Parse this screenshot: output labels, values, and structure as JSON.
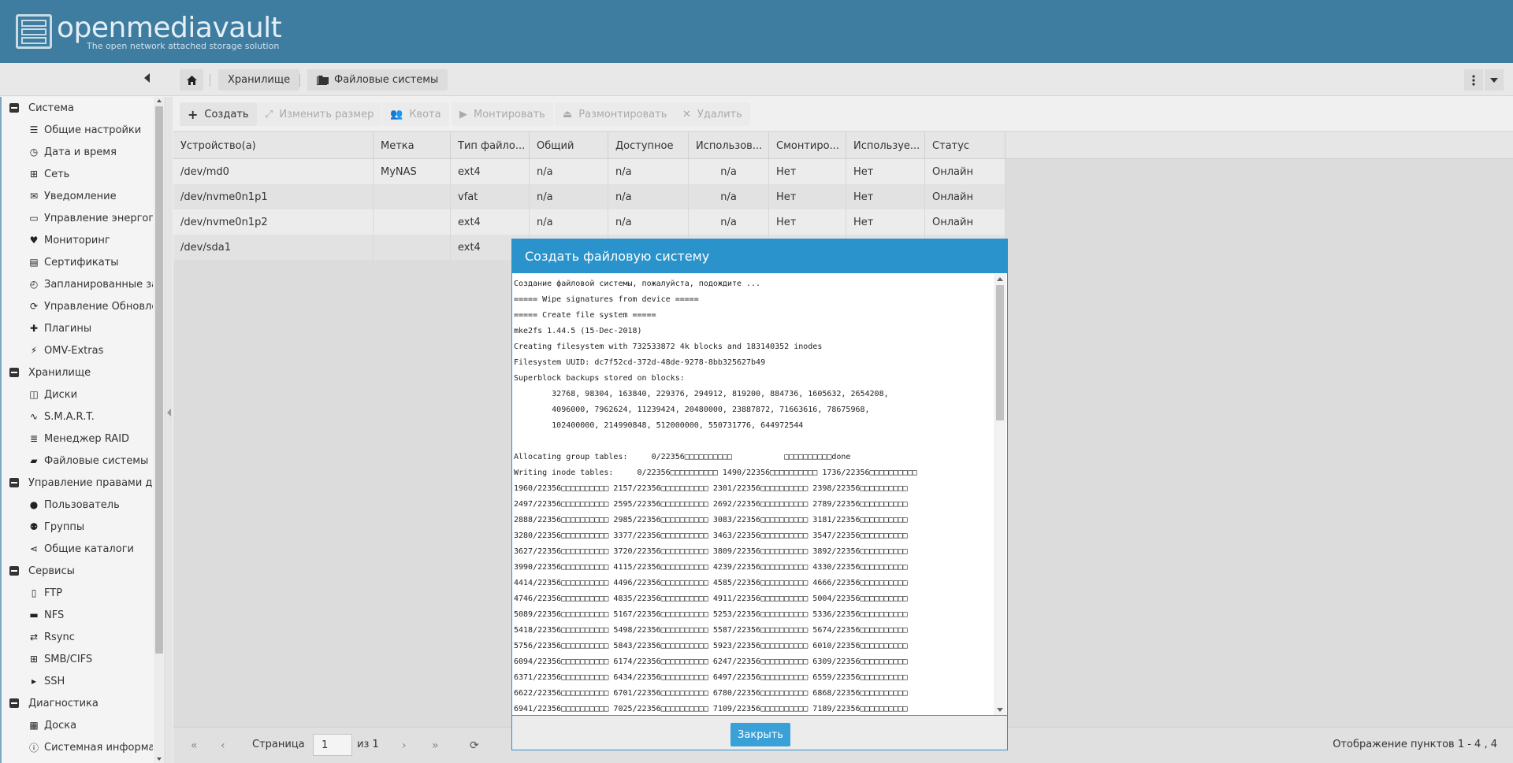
{
  "app": {
    "title": "openmediavault",
    "subtitle": "The open network attached storage solution"
  },
  "breadcrumb": {
    "storage": "Хранилище",
    "filesystems": "Файловые системы"
  },
  "sidebar": {
    "items": [
      {
        "type": "group",
        "label": "Система",
        "icon": "minus"
      },
      {
        "type": "child",
        "label": "Общие настройки",
        "icon": "sliders-icon"
      },
      {
        "type": "child",
        "label": "Дата и время",
        "icon": "clock-icon"
      },
      {
        "type": "child",
        "label": "Сеть",
        "icon": "network-icon"
      },
      {
        "type": "child",
        "label": "Уведомление",
        "icon": "envelope-icon"
      },
      {
        "type": "child",
        "label": "Управление энергопо",
        "icon": "battery-icon"
      },
      {
        "type": "child",
        "label": "Мониторинг",
        "icon": "heartbeat-icon"
      },
      {
        "type": "child",
        "label": "Сертификаты",
        "icon": "certificate-icon"
      },
      {
        "type": "child",
        "label": "Запланированные за",
        "icon": "alarm-clock-icon"
      },
      {
        "type": "child",
        "label": "Управление Обновле",
        "icon": "refresh-icon"
      },
      {
        "type": "child",
        "label": "Плагины",
        "icon": "puzzle-icon"
      },
      {
        "type": "child",
        "label": "OMV-Extras",
        "icon": "plug-icon"
      },
      {
        "type": "group",
        "label": "Хранилище",
        "icon": "minus"
      },
      {
        "type": "child",
        "label": "Диски",
        "icon": "disk-icon"
      },
      {
        "type": "child",
        "label": "S.M.A.R.T.",
        "icon": "pulse-icon"
      },
      {
        "type": "child",
        "label": "Менеджер RAID",
        "icon": "database-icon"
      },
      {
        "type": "child",
        "label": "Файловые системы",
        "icon": "folder-icon"
      },
      {
        "type": "group",
        "label": "Управление правами до",
        "icon": "minus"
      },
      {
        "type": "child",
        "label": "Пользователь",
        "icon": "user-icon"
      },
      {
        "type": "child",
        "label": "Группы",
        "icon": "users-icon"
      },
      {
        "type": "child",
        "label": "Общие каталоги",
        "icon": "share-icon"
      },
      {
        "type": "group",
        "label": "Сервисы",
        "icon": "minus"
      },
      {
        "type": "child",
        "label": "FTP",
        "icon": "ftp-icon"
      },
      {
        "type": "child",
        "label": "NFS",
        "icon": "desktop-icon"
      },
      {
        "type": "child",
        "label": "Rsync",
        "icon": "rsync-icon"
      },
      {
        "type": "child",
        "label": "SMB/CIFS",
        "icon": "windows-icon"
      },
      {
        "type": "child",
        "label": "SSH",
        "icon": "terminal-icon"
      },
      {
        "type": "group",
        "label": "Диагностика",
        "icon": "minus"
      },
      {
        "type": "child",
        "label": "Доска",
        "icon": "dashboard-icon"
      },
      {
        "type": "child",
        "label": "Системная информац",
        "icon": "info-icon"
      }
    ]
  },
  "toolbar": {
    "create": "Создать",
    "resize": "Изменить размер",
    "quota": "Квота",
    "mount": "Монтировать",
    "unmount": "Размонтировать",
    "delete": "Удалить"
  },
  "grid": {
    "columns": [
      "Устройство(а)",
      "Метка",
      "Тип файло...",
      "Общий",
      "Доступное",
      "Использов...",
      "Смонтиро...",
      "Используе...",
      "Статус"
    ],
    "rows": [
      [
        "/dev/md0",
        "MyNAS",
        "ext4",
        "n/a",
        "n/a",
        "n/a",
        "Нет",
        "Нет",
        "Онлайн"
      ],
      [
        "/dev/nvme0n1p1",
        "",
        "vfat",
        "n/a",
        "n/a",
        "n/a",
        "Нет",
        "Нет",
        "Онлайн"
      ],
      [
        "/dev/nvme0n1p2",
        "",
        "ext4",
        "n/a",
        "n/a",
        "n/a",
        "Нет",
        "Нет",
        "Онлайн"
      ],
      [
        "/dev/sda1",
        "",
        "ext4",
        "",
        "",
        "",
        "",
        "",
        ""
      ]
    ]
  },
  "pager": {
    "page_label": "Страница",
    "page_value": "1",
    "of_label": "из 1",
    "display": "Отображение пунктов 1 - 4 , 4"
  },
  "modal": {
    "title": "Создать файловую систему",
    "close_label": "Закрыть",
    "log_lines": [
      "Создание файловой системы, пожалуйста, подождите ...",
      "===== Wipe signatures from device =====",
      "===== Create file system =====",
      "mke2fs 1.44.5 (15-Dec-2018)",
      "Creating filesystem with 732533872 4k blocks and 183140352 inodes",
      "Filesystem UUID: dc7f52cd-372d-48de-9278-8bb325627b49",
      "Superblock backups stored on blocks:",
      "        32768, 98304, 163840, 229376, 294912, 819200, 884736, 1605632, 2654208,",
      "        4096000, 7962624, 11239424, 20480000, 23887872, 71663616, 78675968,",
      "        102400000, 214990848, 512000000, 550731776, 644972544",
      "",
      "Allocating group tables:     0/22356□□□□□□□□□□           □□□□□□□□□□done",
      "Writing inode tables:     0/22356□□□□□□□□□□ 1490/22356□□□□□□□□□□ 1736/22356□□□□□□□□□□",
      "1960/22356□□□□□□□□□□ 2157/22356□□□□□□□□□□ 2301/22356□□□□□□□□□□ 2398/22356□□□□□□□□□□",
      "2497/22356□□□□□□□□□□ 2595/22356□□□□□□□□□□ 2692/22356□□□□□□□□□□ 2789/22356□□□□□□□□□□",
      "2888/22356□□□□□□□□□□ 2985/22356□□□□□□□□□□ 3083/22356□□□□□□□□□□ 3181/22356□□□□□□□□□□",
      "3280/22356□□□□□□□□□□ 3377/22356□□□□□□□□□□ 3463/22356□□□□□□□□□□ 3547/22356□□□□□□□□□□",
      "3627/22356□□□□□□□□□□ 3720/22356□□□□□□□□□□ 3809/22356□□□□□□□□□□ 3892/22356□□□□□□□□□□",
      "3990/22356□□□□□□□□□□ 4115/22356□□□□□□□□□□ 4239/22356□□□□□□□□□□ 4330/22356□□□□□□□□□□",
      "4414/22356□□□□□□□□□□ 4496/22356□□□□□□□□□□ 4585/22356□□□□□□□□□□ 4666/22356□□□□□□□□□□",
      "4746/22356□□□□□□□□□□ 4835/22356□□□□□□□□□□ 4911/22356□□□□□□□□□□ 5004/22356□□□□□□□□□□",
      "5089/22356□□□□□□□□□□ 5167/22356□□□□□□□□□□ 5253/22356□□□□□□□□□□ 5336/22356□□□□□□□□□□",
      "5418/22356□□□□□□□□□□ 5498/22356□□□□□□□□□□ 5587/22356□□□□□□□□□□ 5674/22356□□□□□□□□□□",
      "5756/22356□□□□□□□□□□ 5843/22356□□□□□□□□□□ 5923/22356□□□□□□□□□□ 6010/22356□□□□□□□□□□",
      "6094/22356□□□□□□□□□□ 6174/22356□□□□□□□□□□ 6247/22356□□□□□□□□□□ 6309/22356□□□□□□□□□□",
      "6371/22356□□□□□□□□□□ 6434/22356□□□□□□□□□□ 6497/22356□□□□□□□□□□ 6559/22356□□□□□□□□□□",
      "6622/22356□□□□□□□□□□ 6701/22356□□□□□□□□□□ 6780/22356□□□□□□□□□□ 6868/22356□□□□□□□□□□",
      "6941/22356□□□□□□□□□□ 7025/22356□□□□□□□□□□ 7109/22356□□□□□□□□□□ 7189/22356□□□□□□□□□□"
    ]
  }
}
